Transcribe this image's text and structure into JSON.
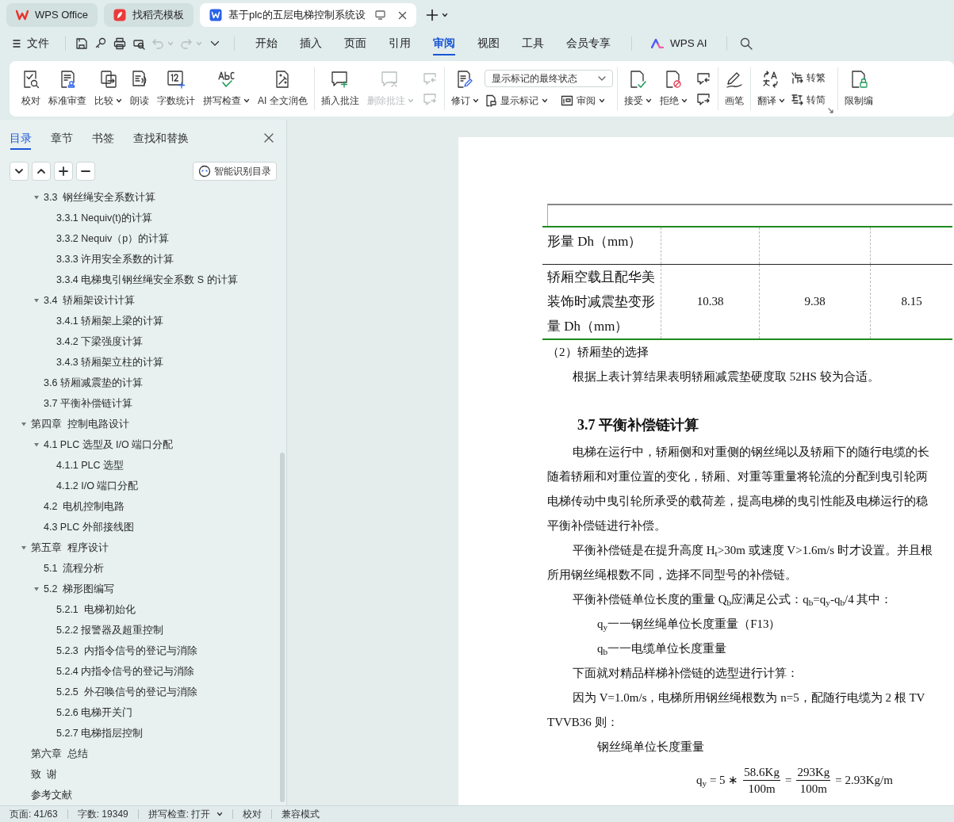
{
  "tabs": [
    {
      "title": "WPS Office",
      "kind": "home",
      "selected": false
    },
    {
      "title": "找稻壳模板",
      "kind": "templates",
      "selected": false
    },
    {
      "title": "基于plc的五层电梯控制系统设",
      "kind": "document",
      "selected": true
    }
  ],
  "menu": {
    "file_label": "文件",
    "quick_actions": [
      {
        "kind": "save",
        "disabled": false
      },
      {
        "kind": "link",
        "disabled": false
      },
      {
        "kind": "print",
        "disabled": false
      },
      {
        "kind": "preview",
        "disabled": false
      },
      {
        "kind": "undo",
        "disabled": true
      },
      {
        "kind": "redo",
        "disabled": true
      }
    ],
    "tabs": [
      {
        "label": "开始",
        "selected": false
      },
      {
        "label": "插入",
        "selected": false
      },
      {
        "label": "页面",
        "selected": false
      },
      {
        "label": "引用",
        "selected": false
      },
      {
        "label": "审阅",
        "selected": true
      },
      {
        "label": "视图",
        "selected": false
      },
      {
        "label": "工具",
        "selected": false
      },
      {
        "label": "会员专享",
        "selected": false
      }
    ],
    "ai_label": "WPS AI"
  },
  "ribbon": {
    "groups": [
      {
        "tools": [
          {
            "kind": "large",
            "label": "校对",
            "dropdown": false,
            "disabled": false
          },
          {
            "kind": "large",
            "label": "标准审查",
            "dropdown": false,
            "disabled": false
          },
          {
            "kind": "large",
            "label": "比较",
            "dropdown": true,
            "disabled": false
          },
          {
            "kind": "large",
            "label": "朗读",
            "dropdown": false,
            "disabled": false
          },
          {
            "kind": "large",
            "label": "字数统计",
            "dropdown": false,
            "disabled": false
          },
          {
            "kind": "large",
            "label": "拼写检查",
            "dropdown": true,
            "disabled": false
          },
          {
            "kind": "large",
            "label": "AI 全文润色",
            "dropdown": false,
            "disabled": false
          }
        ]
      },
      {
        "tools": [
          {
            "kind": "large",
            "label": "插入批注",
            "dropdown": false,
            "disabled": false
          },
          {
            "kind": "large",
            "label": "删除批注",
            "dropdown": true,
            "disabled": true
          },
          {
            "kind": "pair",
            "disabled": true
          }
        ]
      },
      {
        "tools": [
          {
            "kind": "large",
            "label": "修订",
            "dropdown": true,
            "disabled": false
          },
          {
            "kind": "select",
            "value": "显示标记的最终状态",
            "items": [
              {
                "label": "显示标记",
                "dropdown": true
              },
              {
                "label": "审阅",
                "dropdown": true
              }
            ]
          }
        ]
      },
      {
        "tools": [
          {
            "kind": "large",
            "label": "接受",
            "dropdown": true,
            "disabled": false
          },
          {
            "kind": "large",
            "label": "拒绝",
            "dropdown": true,
            "disabled": false
          },
          {
            "kind": "pair",
            "disabled": false
          }
        ]
      },
      {
        "tools": [
          {
            "kind": "large",
            "label": "画笔",
            "dropdown": false,
            "disabled": false
          }
        ]
      },
      {
        "tools": [
          {
            "kind": "large",
            "label": "翻译",
            "dropdown": true,
            "disabled": false
          },
          {
            "kind": "stack",
            "items": [
              {
                "label": "转繁"
              },
              {
                "label": "转简"
              }
            ]
          }
        ]
      },
      {
        "tools": [
          {
            "kind": "large",
            "label": "限制编",
            "dropdown": false,
            "disabled": false
          }
        ]
      }
    ]
  },
  "sidebar": {
    "tabs": [
      {
        "label": "目录",
        "selected": true
      },
      {
        "label": "章节",
        "selected": false
      },
      {
        "label": "书签",
        "selected": false
      },
      {
        "label": "查找和替换",
        "selected": false
      }
    ],
    "smart_toc_label": "智能识别目录",
    "toc": {
      "continued": [
        {
          "label": "3.3  钢丝绳安全系数计算",
          "expanded": true,
          "children": [
            {
              "label": "3.3.1 Nequiv(t)的计算"
            },
            {
              "label": "3.3.2 Nequiv（p）的计算"
            },
            {
              "label": "3.3.3 许用安全系数的计算"
            },
            {
              "label": "3.3.4 电梯曳引钢丝绳安全系数 S 的计算"
            }
          ]
        },
        {
          "label": "3.4  轿厢架设计计算",
          "expanded": true,
          "children": [
            {
              "label": "3.4.1 轿厢架上梁的计算"
            },
            {
              "label": "3.4.2 下梁强度计算"
            },
            {
              "label": "3.4.3 轿厢架立柱的计算"
            }
          ]
        },
        {
          "label": "3.6 轿厢减震垫的计算"
        },
        {
          "label": "3.7 平衡补偿链计算"
        }
      ],
      "items": [
        {
          "label": "第四章  控制电路设计",
          "expanded": true,
          "children": [
            {
              "label": "4.1 PLC 选型及 I/O 端口分配",
              "expanded": true,
              "children": [
                {
                  "label": "4.1.1 PLC 选型"
                },
                {
                  "label": "4.1.2 I/O 端口分配"
                }
              ]
            },
            {
              "label": "4.2  电机控制电路"
            },
            {
              "label": "4.3 PLC 外部接线图"
            }
          ]
        },
        {
          "label": "第五章  程序设计",
          "expanded": true,
          "children": [
            {
              "label": "5.1  流程分析"
            },
            {
              "label": "5.2  梯形图编写",
              "expanded": true,
              "children": [
                {
                  "label": "5.2.1  电梯初始化"
                },
                {
                  "label": "5.2.2 报警器及超重控制"
                },
                {
                  "label": "5.2.3  内指令信号的登记与消除"
                },
                {
                  "label": "5.2.4 内指令信号的登记与消除"
                },
                {
                  "label": "5.2.5  外召唤信号的登记与消除"
                },
                {
                  "label": "5.2.6 电梯开关门"
                },
                {
                  "label": "5.2.7 电梯指层控制"
                }
              ]
            }
          ]
        },
        {
          "label": "第六章  总结"
        },
        {
          "label": "致  谢"
        },
        {
          "label": "参考文献"
        }
      ]
    }
  },
  "document": {
    "table": {
      "rows": [
        {
          "label": "形量 Dh（mm）"
        },
        {
          "label": "轿厢空载且配华美装饰时减震垫变形量 Dh（mm）",
          "values": [
            "10.38",
            "9.38",
            "8.15"
          ]
        }
      ]
    },
    "lines": [
      {
        "kind": "plain",
        "text": "（2）轿厢垫的选择"
      },
      {
        "kind": "first",
        "text": "根据上表计算结果表明轿厢减震垫硬度取 52HS 较为合适。"
      },
      {
        "kind": "heading",
        "text": "3.7 平衡补偿链计算"
      },
      {
        "kind": "first",
        "text": "电梯在运行中，轿厢侧和对重侧的钢丝绳以及轿厢下的随行电缆的长"
      },
      {
        "kind": "plain",
        "text": "随着轿厢和对重位置的变化，轿厢、对重等重量将轮流的分配到曳引轮两"
      },
      {
        "kind": "plain",
        "text": "电梯传动中曳引轮所承受的载荷差，提高电梯的曳引性能及电梯运行的稳"
      },
      {
        "kind": "plain",
        "text": "平衡补偿链进行补偿。"
      },
      {
        "kind": "first",
        "text": "平衡补偿链是在提升高度 H$_{t}$>30m 或速度 V>1.6m/s 时才设置。并且根"
      },
      {
        "kind": "plain",
        "text": "所用钢丝绳根数不同，选择不同型号的补偿链。"
      },
      {
        "kind": "first",
        "text": "平衡补偿链单位长度的重量 Q$_{b}$应满足公式：q$_{b}$=q$_{y}$-q$_{b}$/4 其中："
      },
      {
        "kind": "sub",
        "text": "q$_{y}$一一钢丝绳单位长度重量（F13）"
      },
      {
        "kind": "sub",
        "text": "q$_{b}$一一电缆单位长度重量"
      },
      {
        "kind": "first",
        "text": "下面就对精品样梯补偿链的选型进行计算："
      },
      {
        "kind": "first",
        "text": "因为 V=1.0m/s，电梯所用钢丝绳根数为 n=5，配随行电缆为 2 根 TV"
      },
      {
        "kind": "plain",
        "text": "TVVB36 则："
      },
      {
        "kind": "sub",
        "text": "钢丝绳单位长度重量"
      },
      {
        "kind": "formula",
        "parts": [
          {
            "text": "q$_{y}$ = 5 ∗"
          },
          {
            "num": "58.6Kg",
            "den": "100m"
          },
          {
            "text": "="
          },
          {
            "num": "293Kg",
            "den": "100m"
          },
          {
            "text": "= 2.93Kg/m"
          }
        ]
      }
    ]
  },
  "status_bar": [
    {
      "text": "页面: 41/63",
      "dropdown": false
    },
    {
      "text": "字数: 19349",
      "dropdown": false
    },
    {
      "text": "拼写检查: 打开",
      "dropdown": true
    },
    {
      "text": "校对",
      "dropdown": false
    },
    {
      "text": "兼容模式",
      "dropdown": false
    }
  ]
}
